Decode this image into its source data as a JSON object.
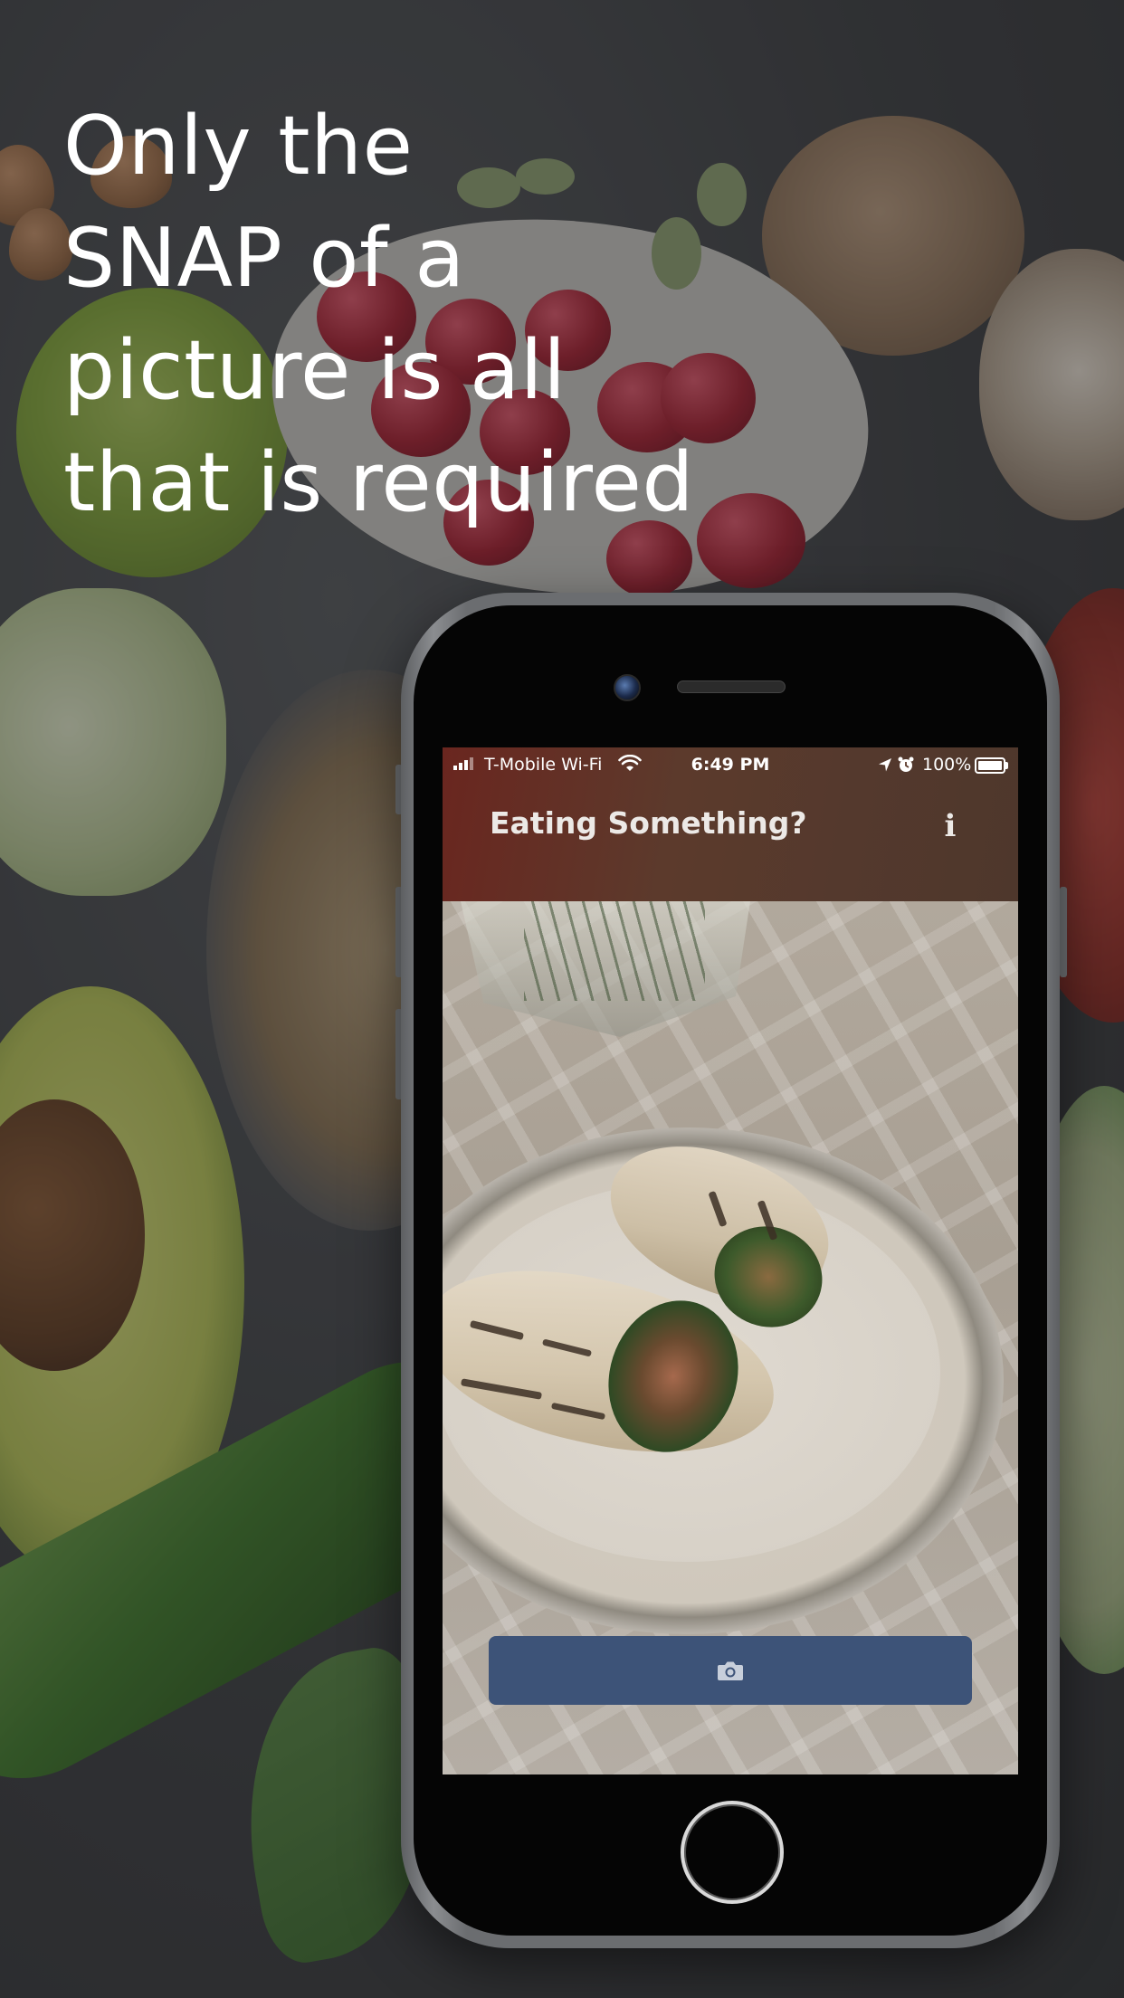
{
  "headline": {
    "lines": [
      "Only the",
      "SNAP of a",
      "picture is all",
      "that is required"
    ]
  },
  "status_bar": {
    "carrier": "T-Mobile Wi-Fi",
    "time": "6:49 PM",
    "battery": "100%",
    "icons": [
      "signal-icon",
      "wifi-icon",
      "location-icon",
      "alarm-icon",
      "battery-icon"
    ]
  },
  "nav": {
    "title": "Eating Something?",
    "info_label": "i"
  },
  "camera_button": {
    "icon": "camera-icon"
  },
  "colors": {
    "nav_bar": "#5c3a2c",
    "camera_button": "#3d5378",
    "headline_text": "#ffffff"
  }
}
